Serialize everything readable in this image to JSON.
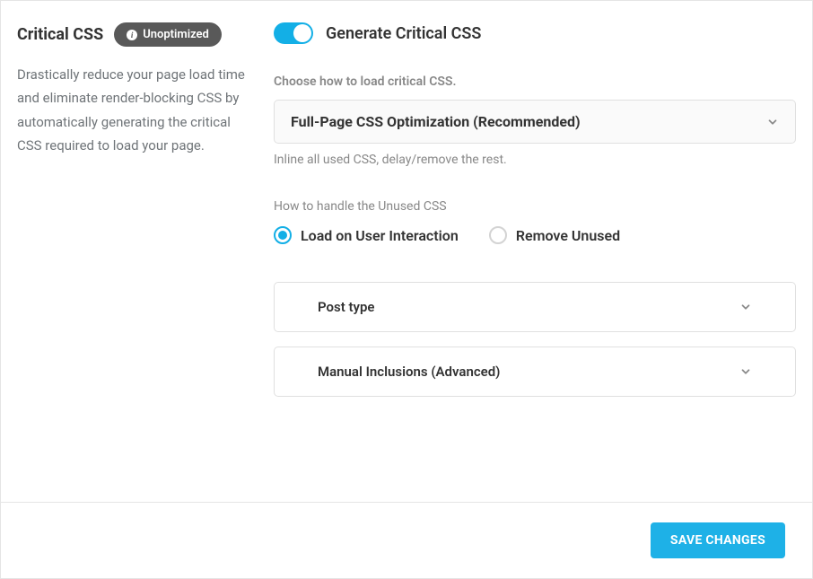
{
  "left": {
    "title": "Critical CSS",
    "badge": "Unoptimized",
    "description": "Drastically reduce your page load time and eliminate render-blocking CSS by automatically generating the critical CSS required to load your page."
  },
  "right": {
    "toggle_label": "Generate Critical CSS",
    "choose_label": "Choose how to load critical CSS.",
    "select_value": "Full-Page CSS Optimization (Recommended)",
    "select_helper": "Inline all used CSS, delay/remove the rest.",
    "unused_label": "How to handle the Unused CSS",
    "radio_options": [
      {
        "label": "Load on User Interaction",
        "selected": true
      },
      {
        "label": "Remove Unused",
        "selected": false
      }
    ],
    "accordion": [
      {
        "label": "Post type"
      },
      {
        "label": "Manual Inclusions (Advanced)"
      }
    ]
  },
  "footer": {
    "save_label": "SAVE CHANGES"
  }
}
